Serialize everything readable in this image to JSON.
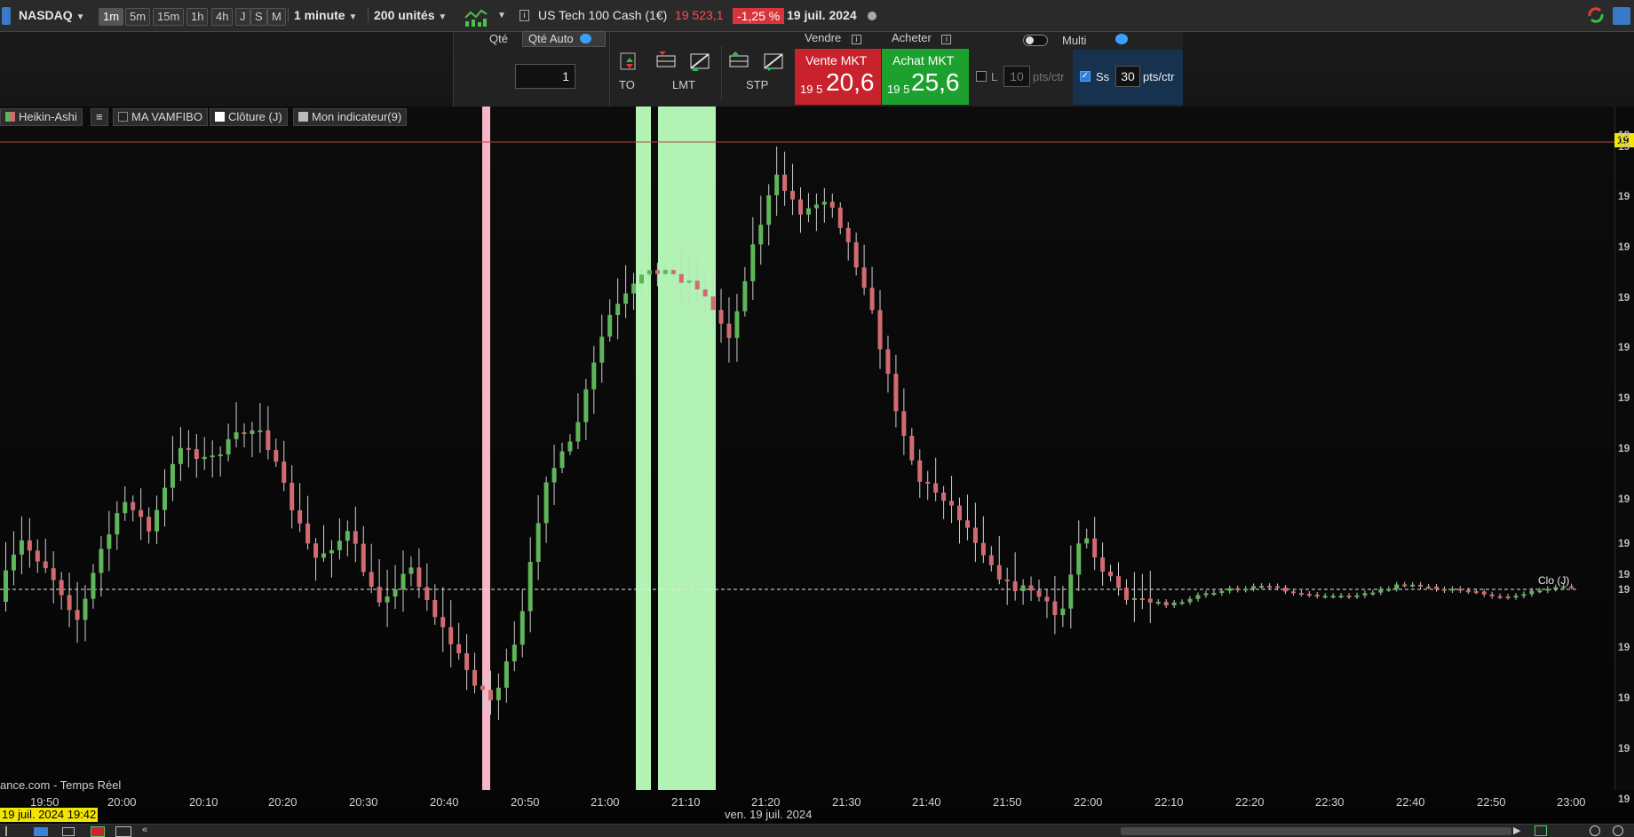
{
  "toolbar": {
    "market": "NASDAQ",
    "timeframes": [
      "1m",
      "5m",
      "15m",
      "1h",
      "4h",
      "J",
      "S",
      "M"
    ],
    "active_timeframe": "1m",
    "period": "1 minute",
    "units": "200 unités",
    "instrument": "US Tech 100 Cash (1€)",
    "last_price": "19 523,1",
    "change": "-1,25 %",
    "date": "19 juil. 2024"
  },
  "trade_panel": {
    "qty_label": "Qté",
    "qty_auto_label": "Qté Auto",
    "qty_value": "1",
    "order_types": {
      "to": "TO",
      "lmt": "LMT",
      "stp": "STP"
    },
    "sell_header": "Vendre",
    "buy_header": "Acheter",
    "sell_button": {
      "label": "Vente MKT",
      "prefix": "19 5",
      "price": "20,6"
    },
    "buy_button": {
      "label": "Achat MKT",
      "prefix": "19 5",
      "price": "25,6"
    },
    "multi_label": "Multi",
    "limit": {
      "label": "L",
      "value": "10",
      "unit": "pts/ctr"
    },
    "stop": {
      "label": "Ss",
      "value": "30",
      "unit": "pts/ctr"
    }
  },
  "indicators": {
    "heikin": "Heikin-Ashi",
    "ma": "MA VAMFIBO",
    "close": "Clôture (J)",
    "custom": "Mon indicateur(9)"
  },
  "chart": {
    "watermark": "ance.com - Temps Réel",
    "x_ticks": [
      "19:50",
      "20:00",
      "20:10",
      "20:20",
      "20:30",
      "20:40",
      "20:50",
      "21:00",
      "21:10",
      "21:20",
      "21:30",
      "21:40",
      "21:50",
      "22:00",
      "22:10",
      "22:20",
      "22:30",
      "22:40",
      "22:50",
      "23:00"
    ],
    "date_caption": "ven. 19 juil. 2024",
    "cursor_time": "19 juil. 2024 19:42",
    "close_line_label": "Clo (J)",
    "price_axis_labels": [
      "19",
      "19",
      "19",
      "19",
      "19",
      "19",
      "19",
      "19",
      "19",
      "19",
      "19",
      "19",
      "19",
      "19",
      "19",
      "19"
    ],
    "price_highlight": "19"
  },
  "colors": {
    "bull": "#5fb55a",
    "bear": "#d26b70",
    "green_band": "#b2f2b4",
    "pink_band": "#f7b6c8",
    "sell_bg": "#c8232c",
    "buy_bg": "#1da12e"
  }
}
